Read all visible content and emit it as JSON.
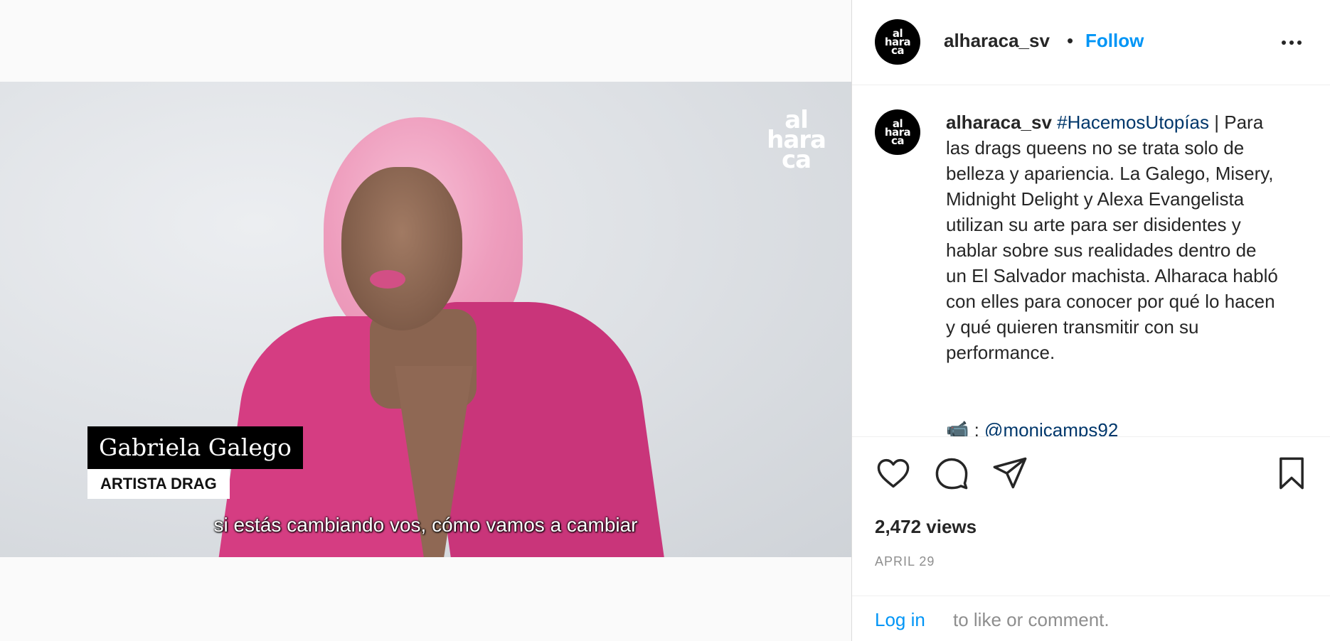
{
  "video": {
    "watermark": [
      "al",
      "hara",
      "ca"
    ],
    "name": "Gabriela Galego",
    "role": "ARTISTA DRAG",
    "subtitle": "si estás cambiando vos, cómo vamos a cambiar"
  },
  "header": {
    "avatar_text": [
      "al",
      "hara",
      "ca"
    ],
    "username": "alharaca_sv",
    "separator": "•",
    "follow_label": "Follow",
    "more_icon": "more-horizontal-icon"
  },
  "caption": {
    "username": "alharaca_sv",
    "hashtag": "#HacemosUtopías",
    "text": " | Para las drags queens no se trata solo de belleza y apariencia. La Galego, Misery, Midnight Delight y Alexa Evangelista utilizan su arte para ser disidentes y hablar sobre sus realidades dentro de un El Salvador machista. Alharaca habló con elles para conocer por qué lo hacen y qué quieren transmitir con su performance.",
    "credit_icon": "📹",
    "credit_sep": " : ",
    "credit_handle": "@monicamps92"
  },
  "actions": {
    "like_icon": "heart-icon",
    "comment_icon": "comment-icon",
    "share_icon": "paper-plane-icon",
    "save_icon": "bookmark-icon"
  },
  "stats": {
    "views": "2,472 views",
    "date": "APRIL 29"
  },
  "footer": {
    "login_label": "Log in",
    "login_rest": "to like or comment."
  },
  "colors": {
    "accent": "#0095f6",
    "link": "#00376b",
    "muted": "#8e8e8e",
    "jacket": "#d53d82",
    "hair": "#ee9dbd"
  }
}
